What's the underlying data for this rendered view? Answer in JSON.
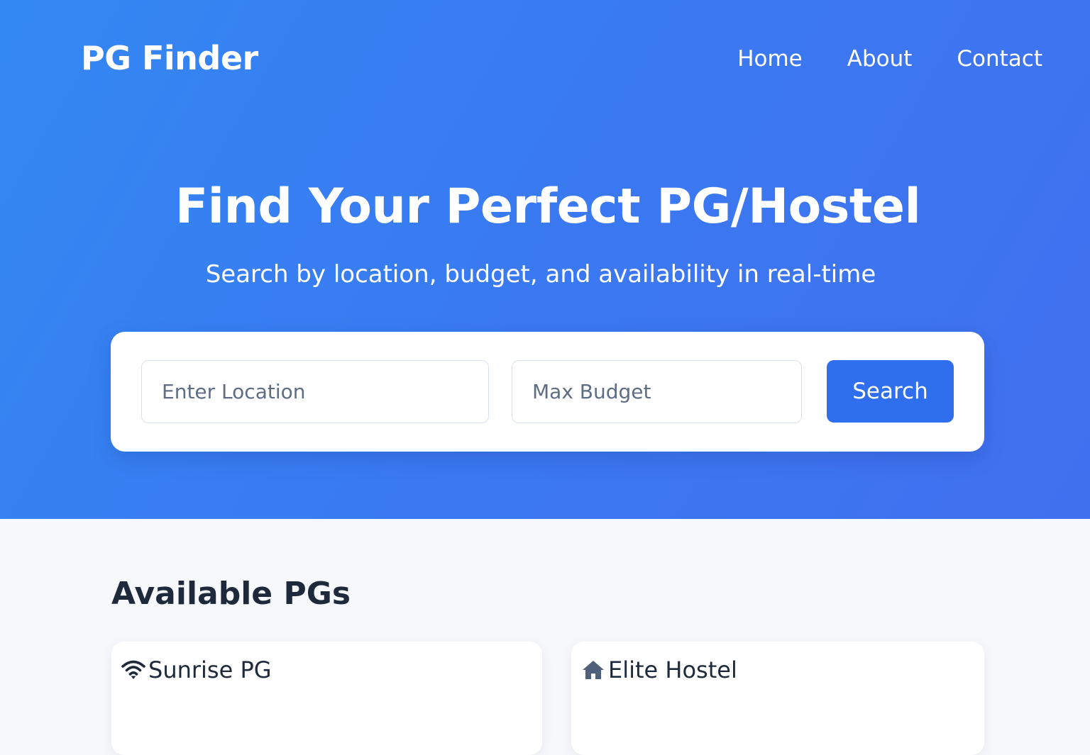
{
  "header": {
    "brand": "PG Finder",
    "nav": [
      "Home",
      "About",
      "Contact"
    ]
  },
  "hero": {
    "title": "Find Your Perfect PG/Hostel",
    "subtitle": "Search by location, budget, and availability in real-time"
  },
  "search": {
    "location_placeholder": "Enter Location",
    "budget_placeholder": "Max Budget",
    "button_label": "Search"
  },
  "results": {
    "title": "Available PGs",
    "listings": [
      {
        "name": "Sunrise PG",
        "icon": "wifi-icon"
      },
      {
        "name": "Elite Hostel",
        "icon": "home-icon"
      }
    ]
  },
  "colors": {
    "hero_gradient_start": "#3388f3",
    "hero_gradient_end": "#4170ef",
    "accent": "#2f6fed",
    "heading_text": "#1e2a3b",
    "page_background": "#f7f8fc"
  }
}
